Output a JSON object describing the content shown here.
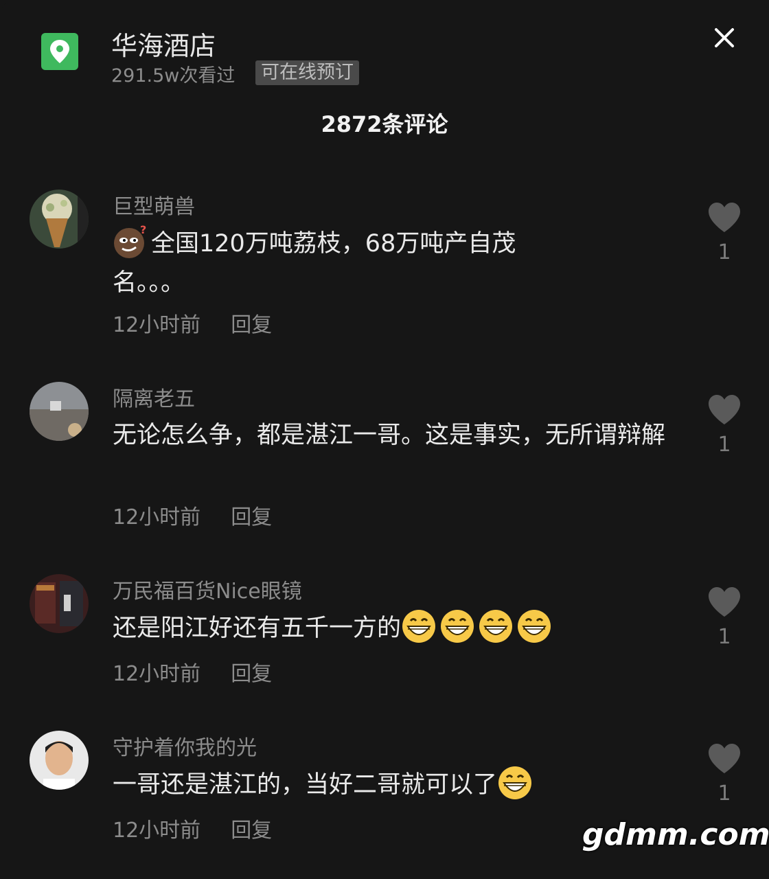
{
  "poi": {
    "name": "华海酒店",
    "views": "291.5w次看过",
    "badge": "可在线预订"
  },
  "comments_title": "2872条评论",
  "comments": [
    {
      "user": "巨型萌兽",
      "text_parts": [
        "",
        "全国120万吨荔枝，68万吨产自茂",
        "名。。。"
      ],
      "time": "12小时前",
      "reply": "回复",
      "likes": "1",
      "emoji": "question-face-emoji"
    },
    {
      "user": "隔离老五",
      "text": "无论怎么争，都是湛江一哥。这是事实，无所谓辩解",
      "time": "12小时前",
      "reply": "回复",
      "likes": "1"
    },
    {
      "user": "万民福百货Nice眼镜",
      "text": "还是阳江好还有五千一方的",
      "time": "12小时前",
      "reply": "回复",
      "likes": "1",
      "emoji": "grinning-face-emoji"
    },
    {
      "user": "守护着你我的光",
      "text": "一哥还是湛江的，当好二哥就可以了",
      "time": "12小时前",
      "reply": "回复",
      "likes": "1",
      "emoji": "grinning-face-emoji"
    }
  ],
  "watermark": "gdmm.com",
  "colors": {
    "background": "#161616",
    "poi_icon": "#3fb95e",
    "like_icon": "#5a5a5a"
  }
}
